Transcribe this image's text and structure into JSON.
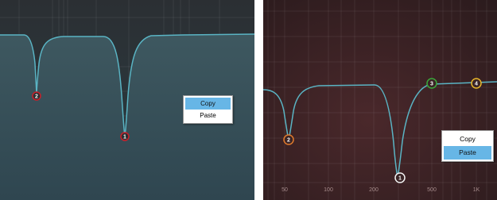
{
  "colors": {
    "left_background": "#3a5159",
    "right_background": "#3e2023",
    "curve": "#5ab4c4",
    "menu_highlight": "#67b6e6"
  },
  "left_panel": {
    "nodes": [
      {
        "label": "2",
        "color": "#c8202a"
      },
      {
        "label": "1",
        "color": "#c8202a"
      }
    ],
    "context_menu": {
      "items": [
        {
          "label": "Copy",
          "highlighted": true
        },
        {
          "label": "Paste",
          "highlighted": false
        }
      ]
    }
  },
  "right_panel": {
    "nodes": [
      {
        "label": "2",
        "color": "#e07a2c"
      },
      {
        "label": "1",
        "color": "#f2f2f2"
      },
      {
        "label": "3",
        "color": "#3aa83a"
      },
      {
        "label": "4",
        "color": "#e8b62a"
      }
    ],
    "frequency_labels": [
      "50",
      "100",
      "200",
      "500",
      "1K"
    ],
    "context_menu": {
      "items": [
        {
          "label": "Copy",
          "highlighted": false
        },
        {
          "label": "Paste",
          "highlighted": true
        }
      ]
    }
  }
}
